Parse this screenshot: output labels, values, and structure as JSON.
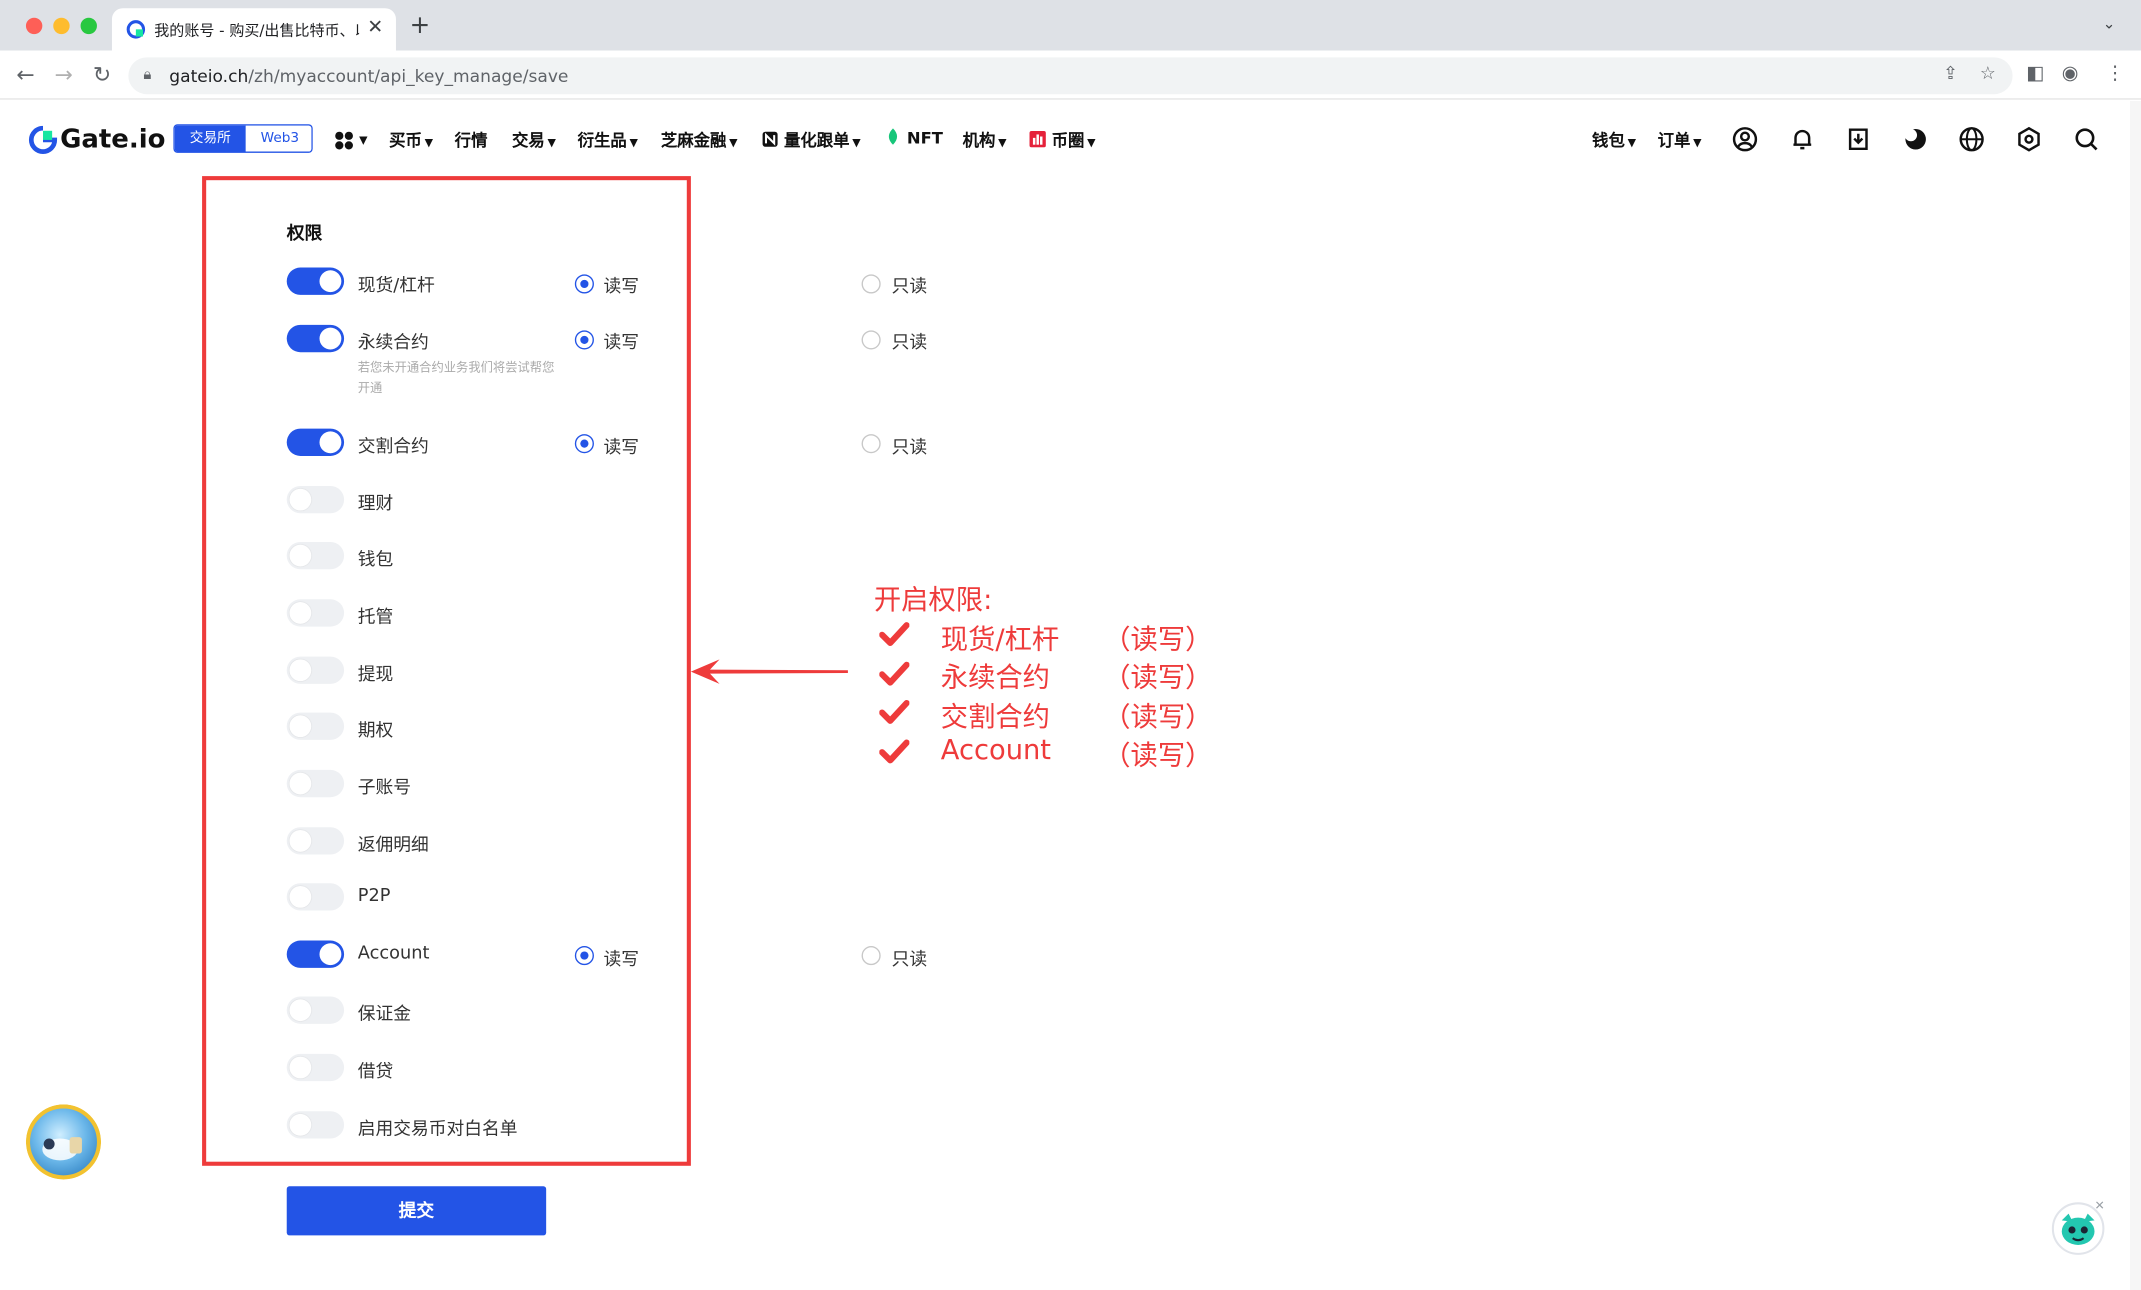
{
  "browser": {
    "tab_title": "我的账号 - 购买/出售比特币、以",
    "tab_close": "✕",
    "new_tab": "+",
    "tab_menu": "⌄",
    "url_host": "gateio.ch",
    "url_path": "/zh/myaccount/api_key_manage/save"
  },
  "header": {
    "logo": "Gate.io",
    "switch": {
      "exchange": "交易所",
      "web3": "Web3"
    },
    "nav": {
      "buy": "买币",
      "market": "行情",
      "trade": "交易",
      "derivatives": "衍生品",
      "finance": "芝麻金融",
      "copy_trading": "量化跟单",
      "nft": "NFT",
      "institution": "机构",
      "circle": "币圈"
    },
    "wallet": "钱包",
    "orders": "订单"
  },
  "permissions": {
    "title": "权限",
    "read_write": "读写",
    "read_only": "只读",
    "items": [
      {
        "label": "现货/杠杆",
        "enabled": true
      },
      {
        "label": "永续合约",
        "enabled": true,
        "hint": "若您未开通合约业务我们将尝试帮您开通"
      },
      {
        "label": "交割合约",
        "enabled": true
      },
      {
        "label": "理财",
        "enabled": false
      },
      {
        "label": "钱包",
        "enabled": false
      },
      {
        "label": "托管",
        "enabled": false
      },
      {
        "label": "提现",
        "enabled": false
      },
      {
        "label": "期权",
        "enabled": false
      },
      {
        "label": "子账号",
        "enabled": false
      },
      {
        "label": "返佣明细",
        "enabled": false
      },
      {
        "label": "P2P",
        "enabled": false
      },
      {
        "label": "Account",
        "enabled": true
      },
      {
        "label": "保证金",
        "enabled": false
      },
      {
        "label": "借贷",
        "enabled": false
      },
      {
        "label": "启用交易币对白名单",
        "enabled": false
      }
    ]
  },
  "annotation": {
    "title": "开启权限:",
    "items": [
      {
        "name": "现货/杠杆",
        "mode": "（读写）"
      },
      {
        "name": "永续合约",
        "mode": "（读写）"
      },
      {
        "name": "交割合约",
        "mode": "（读写）"
      },
      {
        "name": "Account",
        "mode": "（读写）"
      }
    ]
  },
  "submit_label": "提交",
  "colors": {
    "brand_blue": "#2354e6",
    "annotation_red": "#ee3b3b",
    "toggle_off": "#eef0f3"
  }
}
